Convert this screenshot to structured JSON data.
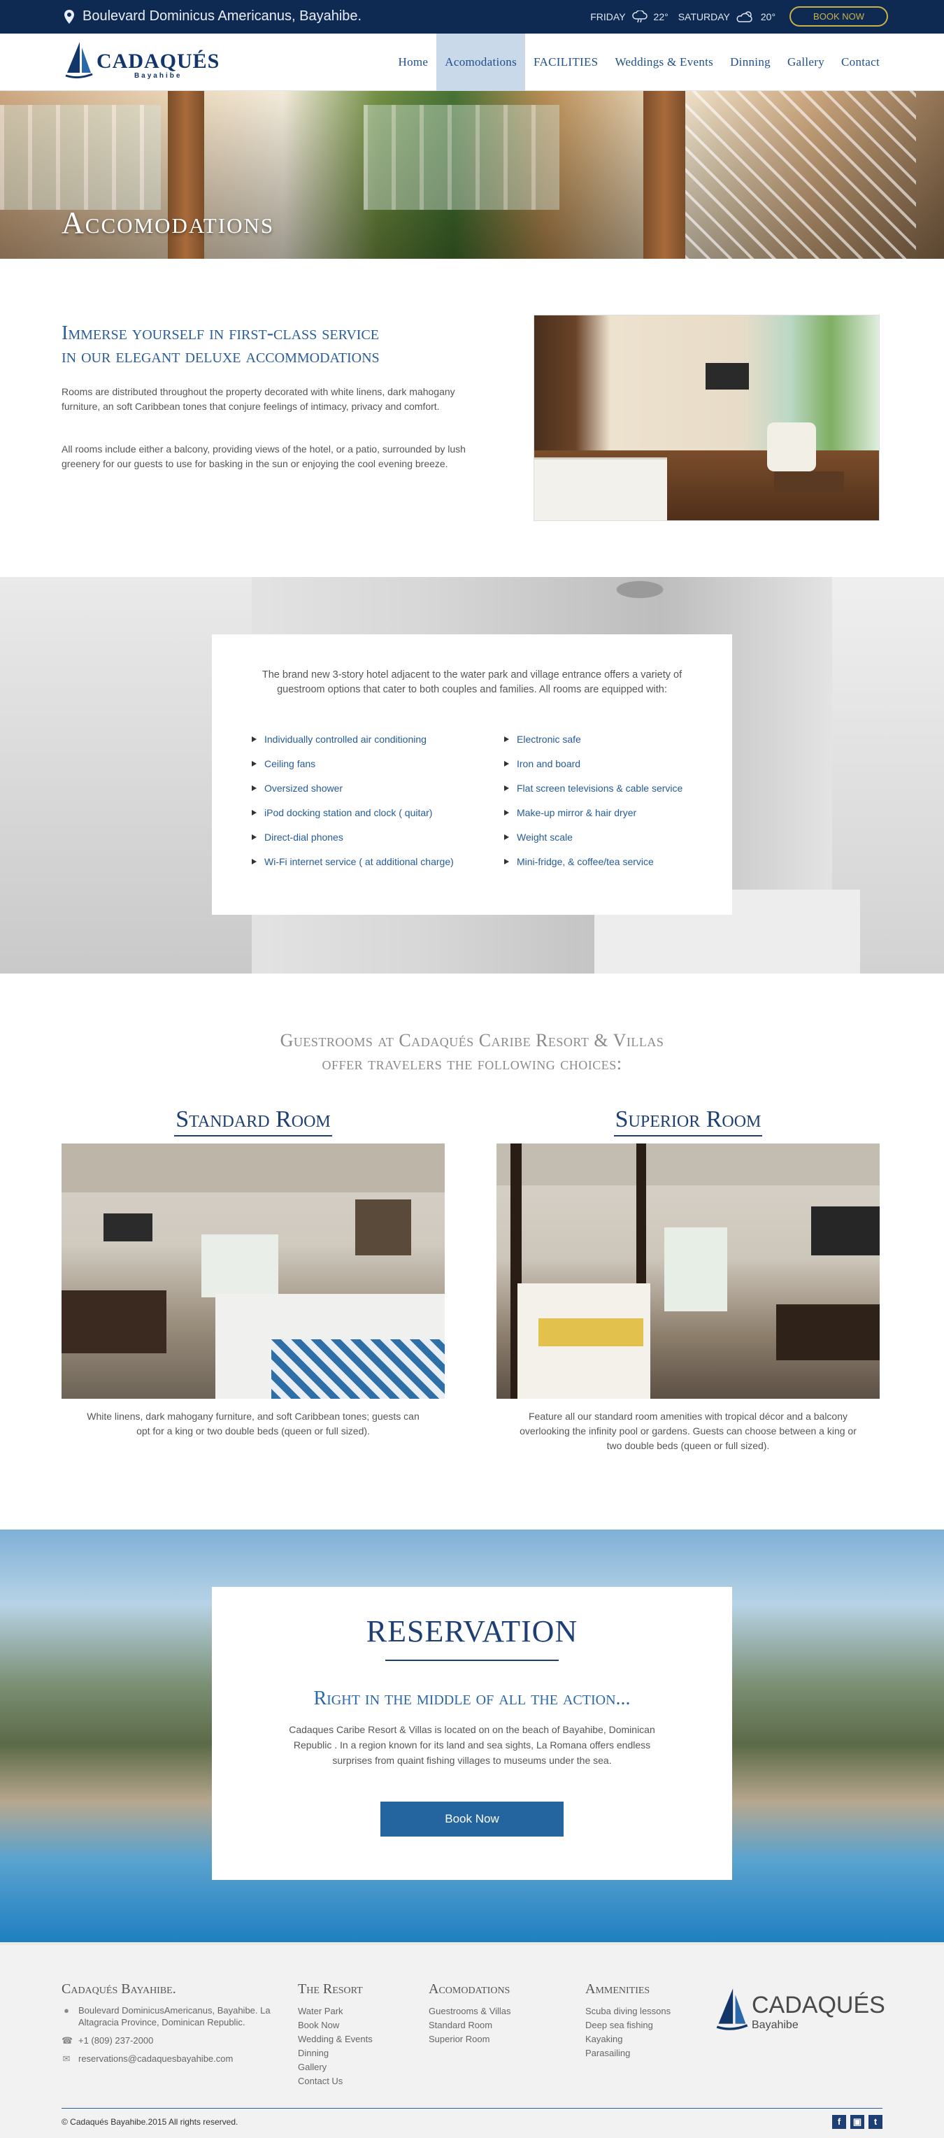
{
  "topbar": {
    "address": "Boulevard Dominicus Americanus, Bayahibe.",
    "weather": [
      {
        "day": "FRIDAY",
        "temp": "22°",
        "icon": "rain-cloud-icon"
      },
      {
        "day": "SATURDAY",
        "temp": "20°",
        "icon": "cloud-sun-icon"
      }
    ],
    "book_label": "BOOK NOW"
  },
  "brand": {
    "name": "CADAQUÉS",
    "sub": "Bayahibe"
  },
  "nav": {
    "items": [
      "Home",
      "Acomodations",
      "FACILITIES",
      "Weddings & Events",
      "Dinning",
      "Gallery",
      "Contact"
    ],
    "active": "Acomodations"
  },
  "hero": {
    "title": "Accomodations"
  },
  "intro": {
    "heading_line1": "Immerse yourself in first-class service",
    "heading_line2": "in our elegant deluxe accommodations",
    "p1": "Rooms are distributed throughout the property decorated with white linens, dark mahogany furniture, an soft Caribbean tones that conjure feelings of intimacy, privacy and comfort.",
    "p2": "All rooms include either a balcony, providing views of the hotel, or a patio, surrounded by lush greenery for our guests to use for basking in the sun or enjoying the cool evening breeze."
  },
  "amenities": {
    "lead": "The brand new 3-story hotel adjacent to the water park and village entrance offers a variety of guestroom options that cater to both couples and families.  All rooms are equipped with:",
    "col1": [
      "Individually controlled air conditioning",
      "Ceiling fans",
      "Oversized shower",
      "iPod docking station and clock ( quitar)",
      "Direct-dial phones",
      "Wi-Fi internet service ( at additional charge)"
    ],
    "col2": [
      "Electronic safe",
      "Iron and board",
      "Flat screen televisions & cable service",
      "Make-up mirror  & hair dryer",
      "Weight scale",
      "Mini-fridge, & coffee/tea service"
    ]
  },
  "rooms": {
    "heading_line1": "Guestrooms at Cadaqués Caribe Resort & Villas",
    "heading_line2": "offer travelers the following choices:",
    "standard": {
      "title": "Standard Room",
      "desc": "White linens, dark mahogany furniture, and soft Caribbean tones; guests can opt for a king or two double beds (queen or full sized)."
    },
    "superior": {
      "title": "Superior Room",
      "desc": "Feature all our standard room amenities with tropical décor and a balcony overlooking the infinity pool or gardens. Guests can choose between a king or two double beds (queen or full sized)."
    }
  },
  "reservation": {
    "title": "RESERVATION",
    "subtitle": "Right in the middle of all the action...",
    "text": "Cadaques Caribe Resort & Villas is located on on the beach of Bayahibe, Dominican Republic .  In a region known for its land and sea sights, La Romana offers endless surprises from quaint fishing villages to museums under the sea.",
    "button": "Book Now"
  },
  "footer": {
    "col1": {
      "title": "Cadaqués Bayahibe.",
      "address": "Boulevard DominicusAmericanus, Bayahibe. La Altagracia Province, Dominican Republic.",
      "phone": "+1 (809) 237-2000",
      "email": "reservations@cadaquesbayahibe.com"
    },
    "col2": {
      "title": "The Resort",
      "items": [
        "Water Park",
        "Book Now",
        "Wedding & Events",
        "Dinning",
        "Gallery",
        "Contact Us"
      ]
    },
    "col3": {
      "title": "Acomodations",
      "items": [
        "Guestrooms & Villas",
        "Standard Room",
        "Superior Room"
      ]
    },
    "col4": {
      "title": "Ammenities",
      "items": [
        "Scuba diving lessons",
        "Deep sea fishing",
        "Kayaking",
        "Parasailing"
      ]
    },
    "copyright": "© Cadaqués Bayahibe.2015 All rights reserved.",
    "social": [
      "facebook-icon",
      "instagram-icon",
      "twitter-icon"
    ]
  }
}
